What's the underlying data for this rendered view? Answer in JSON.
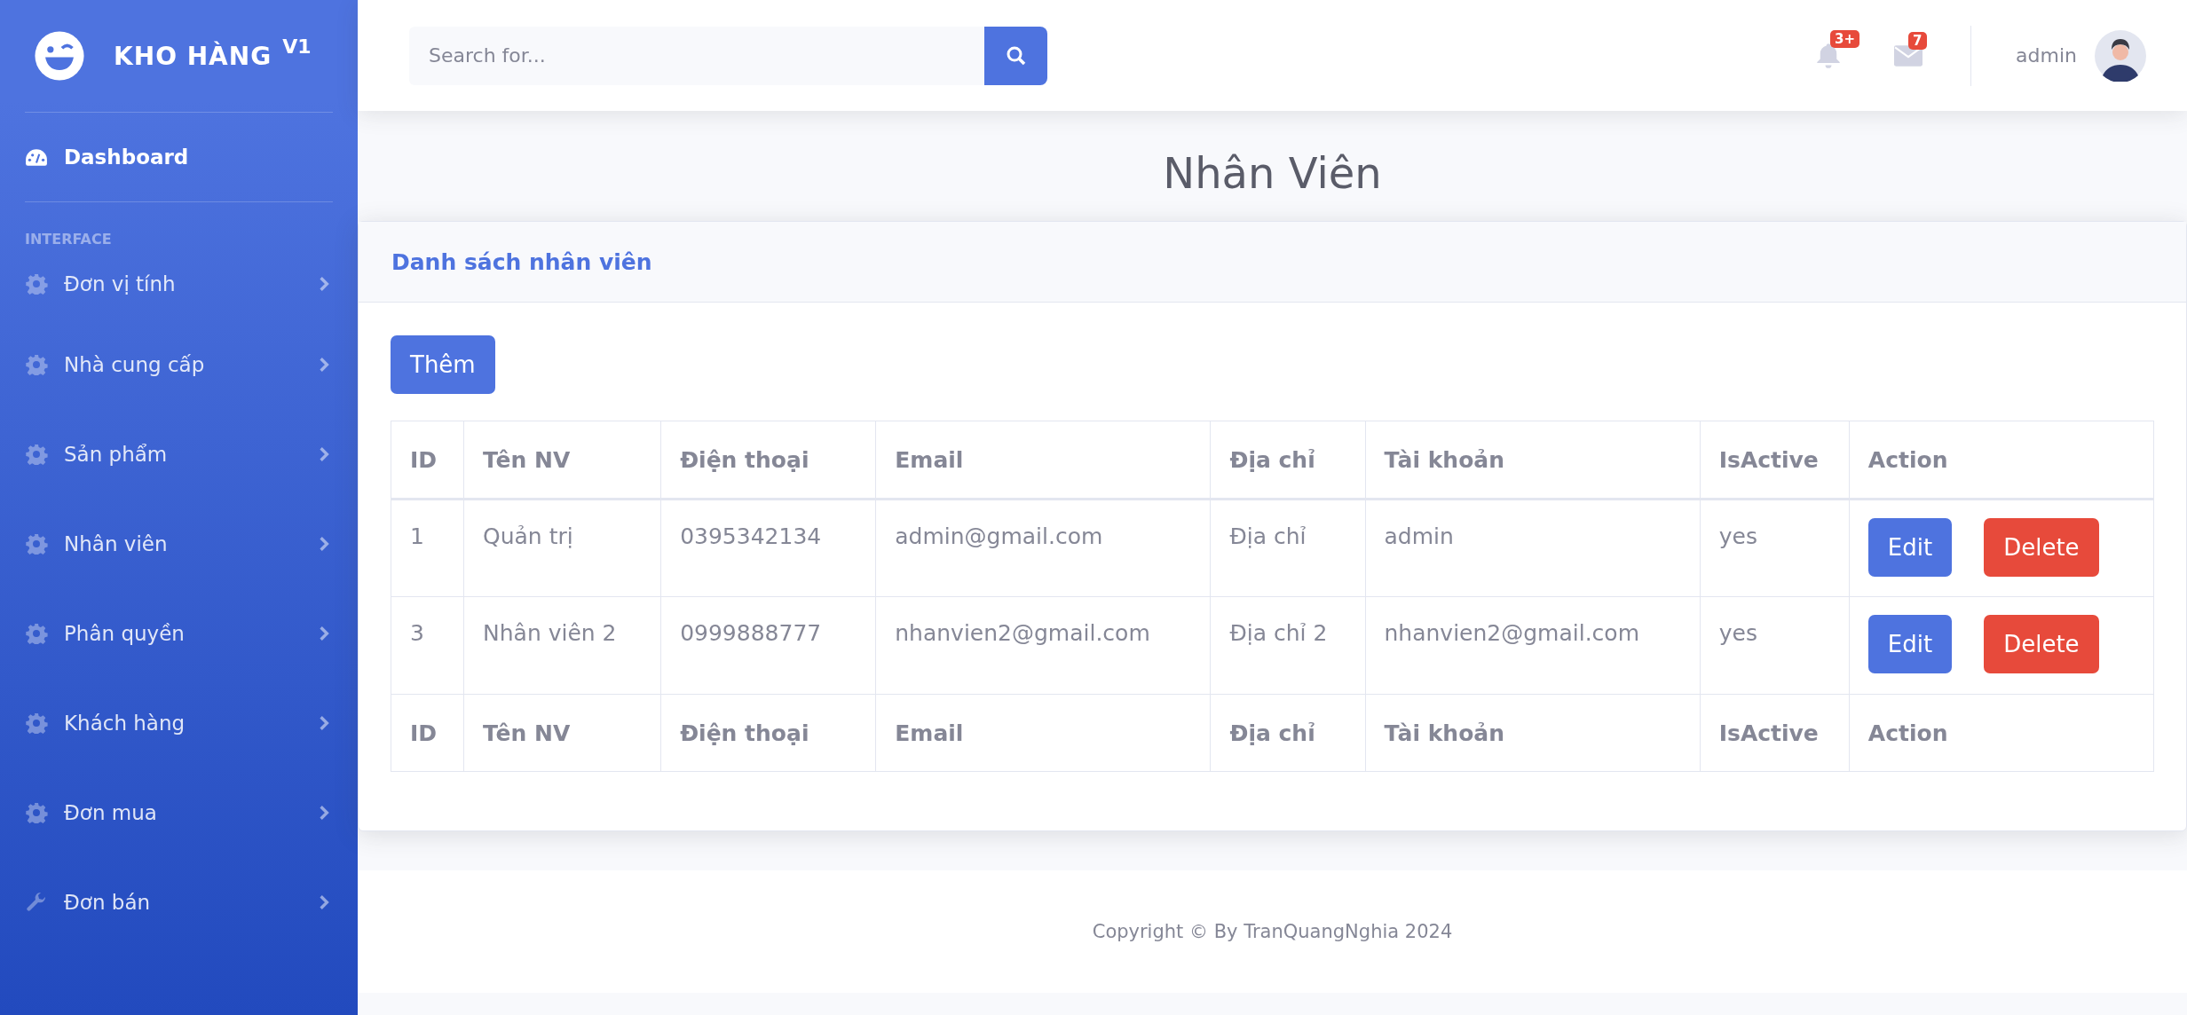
{
  "brand": {
    "name": "KHO HÀNG",
    "version": "V1"
  },
  "sidebar": {
    "items": [
      {
        "label": "Dashboard",
        "kind": "link",
        "selected": true
      }
    ],
    "heading": "INTERFACE",
    "sections": [
      {
        "label": "Đơn vị tính",
        "expanded": false
      },
      {
        "label": "Nhà cung cấp",
        "expanded": false
      },
      {
        "label": "Sản phẩm",
        "expanded": false
      },
      {
        "label": "Nhân viên",
        "expanded": false
      },
      {
        "label": "Phân quyền",
        "expanded": false
      },
      {
        "label": "Khách hàng",
        "expanded": false
      },
      {
        "label": "Đơn mua",
        "expanded": false
      },
      {
        "label": "Đơn bán",
        "expanded": false
      }
    ]
  },
  "topbar": {
    "search": {
      "placeholder": "Search for..."
    },
    "alerts_badge": "3+",
    "messages_badge": "7",
    "user": "admin"
  },
  "page_title": "Nhân Viên",
  "card": {
    "title": "Danh sách nhân viên",
    "add_button": "Thêm",
    "table": {
      "columns": [
        "ID",
        "Tên NV",
        "Điện thoại",
        "Email",
        "Địa chỉ",
        "Tài khoản",
        "IsActive",
        "Action"
      ],
      "rows": [
        {
          "cells": [
            "1",
            "Quản trị",
            "0395342134",
            "admin@gmail.com",
            "Địa chỉ",
            "admin",
            "yes"
          ],
          "actions": [
            {
              "label": "Edit",
              "kind": "edit"
            },
            {
              "label": "Delete",
              "kind": "delete"
            }
          ]
        },
        {
          "cells": [
            "3",
            "Nhân viên 2",
            "0999888777",
            "nhanvien2@gmail.com",
            "Địa chỉ 2",
            "nhanvien2@gmail.com",
            "yes"
          ],
          "actions": [
            {
              "label": "Edit",
              "kind": "edit"
            },
            {
              "label": "Delete",
              "kind": "delete"
            }
          ]
        }
      ],
      "footer_columns": [
        "ID",
        "Tên NV",
        "Điện thoại",
        "Email",
        "Địa chỉ",
        "Tài khoản",
        "IsActive",
        "Action"
      ]
    }
  },
  "footer": "Copyright © By TranQuangNghia 2024"
}
